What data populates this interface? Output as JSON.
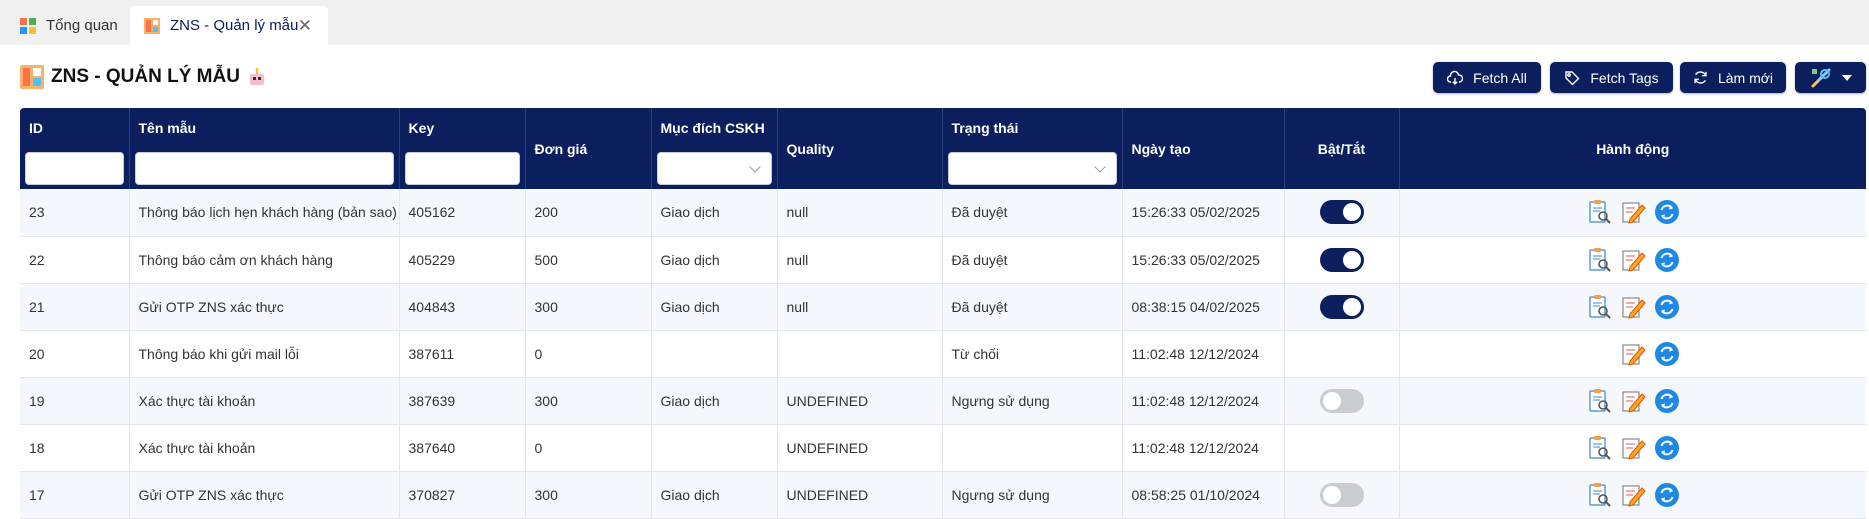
{
  "tabs": [
    {
      "label": "Tổng quan"
    },
    {
      "label": "ZNS - Quản lý mẫu"
    }
  ],
  "page": {
    "title": "ZNS - QUẢN LÝ MẪU"
  },
  "toolbar": {
    "fetch_all": "Fetch All",
    "fetch_tags": "Fetch Tags",
    "refresh": "Làm mới"
  },
  "table": {
    "columns": [
      "ID",
      "Tên mẫu",
      "Key",
      "Đơn giá",
      "Mục đích CSKH",
      "Quality",
      "Trạng thái",
      "Ngày tạo",
      "Bật/Tắt",
      "Hành động"
    ],
    "rows": [
      {
        "id": "23",
        "name": "Thông báo lịch hẹn khách hàng (bản sao)",
        "key": "405162",
        "price": "200",
        "purpose": "Giao dịch",
        "quality": "null",
        "status": "Đã duyệt",
        "created": "15:26:33 05/02/2025",
        "toggle": "on",
        "actions": [
          "view",
          "edit",
          "sync"
        ]
      },
      {
        "id": "22",
        "name": "Thông báo cảm ơn khách hàng",
        "key": "405229",
        "price": "500",
        "purpose": "Giao dịch",
        "quality": "null",
        "status": "Đã duyệt",
        "created": "15:26:33 05/02/2025",
        "toggle": "on",
        "actions": [
          "view",
          "edit",
          "sync"
        ]
      },
      {
        "id": "21",
        "name": "Gửi OTP ZNS xác thực",
        "key": "404843",
        "price": "300",
        "purpose": "Giao dịch",
        "quality": "null",
        "status": "Đã duyệt",
        "created": "08:38:15 04/02/2025",
        "toggle": "on",
        "actions": [
          "view",
          "edit",
          "sync"
        ]
      },
      {
        "id": "20",
        "name": "Thông báo khi gửi mail lỗi",
        "key": "387611",
        "price": "0",
        "purpose": "",
        "quality": "",
        "status": "Từ chối",
        "created": "11:02:48 12/12/2024",
        "toggle": "none",
        "actions": [
          "edit",
          "sync"
        ]
      },
      {
        "id": "19",
        "name": "Xác thực tài khoản",
        "key": "387639",
        "price": "300",
        "purpose": "Giao dịch",
        "quality": "UNDEFINED",
        "status": "Ngưng sử dụng",
        "created": "11:02:48 12/12/2024",
        "toggle": "off",
        "actions": [
          "view",
          "edit",
          "sync"
        ]
      },
      {
        "id": "18",
        "name": "Xác thực tài khoản",
        "key": "387640",
        "price": "0",
        "purpose": "",
        "quality": "UNDEFINED",
        "status": "",
        "created": "11:02:48 12/12/2024",
        "toggle": "none",
        "actions": [
          "view",
          "edit",
          "sync"
        ]
      },
      {
        "id": "17",
        "name": "Gửi OTP ZNS xác thực",
        "key": "370827",
        "price": "300",
        "purpose": "Giao dịch",
        "quality": "UNDEFINED",
        "status": "Ngưng sử dụng",
        "created": "08:58:25 01/10/2024",
        "toggle": "off",
        "actions": [
          "view",
          "edit",
          "sync"
        ]
      }
    ]
  },
  "colors": {
    "header_bg": "#0b1f5e",
    "toggle_on": "#0b1f5e",
    "toggle_off": "#c9ccd2",
    "row_alt": "#f4f7fb",
    "sync_icon": "#1e88e5"
  }
}
